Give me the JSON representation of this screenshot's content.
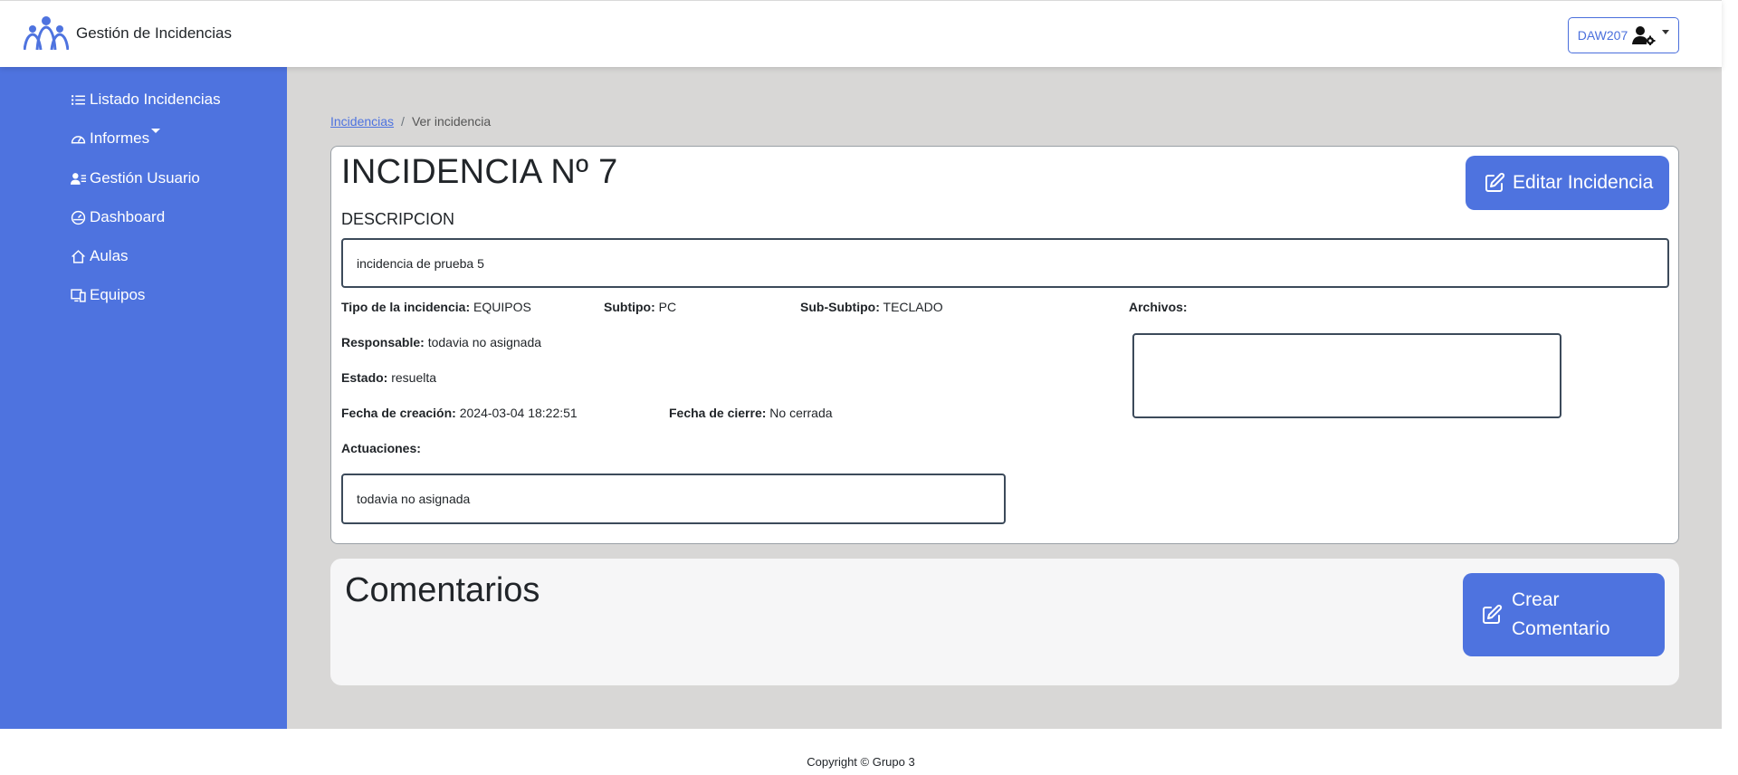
{
  "header": {
    "brand_name": "Gestión de Incidencias",
    "user_label": "DAW207",
    "accent_color": "#4e73df"
  },
  "sidebar": {
    "items": [
      {
        "label": "Listado Incidencias",
        "icon": "list-icon"
      },
      {
        "label": "Informes",
        "icon": "gauge-icon"
      },
      {
        "label": "Gestión Usuario",
        "icon": "user-list-icon"
      },
      {
        "label": "Dashboard",
        "icon": "speedometer-icon"
      },
      {
        "label": "Aulas",
        "icon": "house-icon"
      },
      {
        "label": "Equipos",
        "icon": "devices-icon"
      }
    ]
  },
  "breadcrumb": {
    "link": "Incidencias",
    "separator": "/",
    "current": "Ver incidencia"
  },
  "incident": {
    "title": "INCIDENCIA Nº 7",
    "edit_button": "Editar Incidencia",
    "description_label": "DESCRIPCION",
    "description": "incidencia de prueba 5",
    "tipo_label": "Tipo de la incidencia:",
    "tipo": "EQUIPOS",
    "subtipo_label": "Subtipo:",
    "subtipo": "PC",
    "subsubtipo_label": "Sub-Subtipo:",
    "subsubtipo": "TECLADO",
    "archivos_label": "Archivos:",
    "responsable_label": "Responsable:",
    "responsable": "todavia no asignada",
    "estado_label": "Estado:",
    "estado": "resuelta",
    "fecha_creacion_label": "Fecha de creación:",
    "fecha_creacion": "2024-03-04 18:22:51",
    "fecha_cierre_label": "Fecha de cierre:",
    "fecha_cierre": "No cerrada",
    "actuaciones_label": "Actuaciones:",
    "actuaciones": "todavia no asignada"
  },
  "comments": {
    "title": "Comentarios",
    "create_button": "Crear Comentario"
  },
  "footer": {
    "copyright": "Copyright © Grupo 3"
  }
}
